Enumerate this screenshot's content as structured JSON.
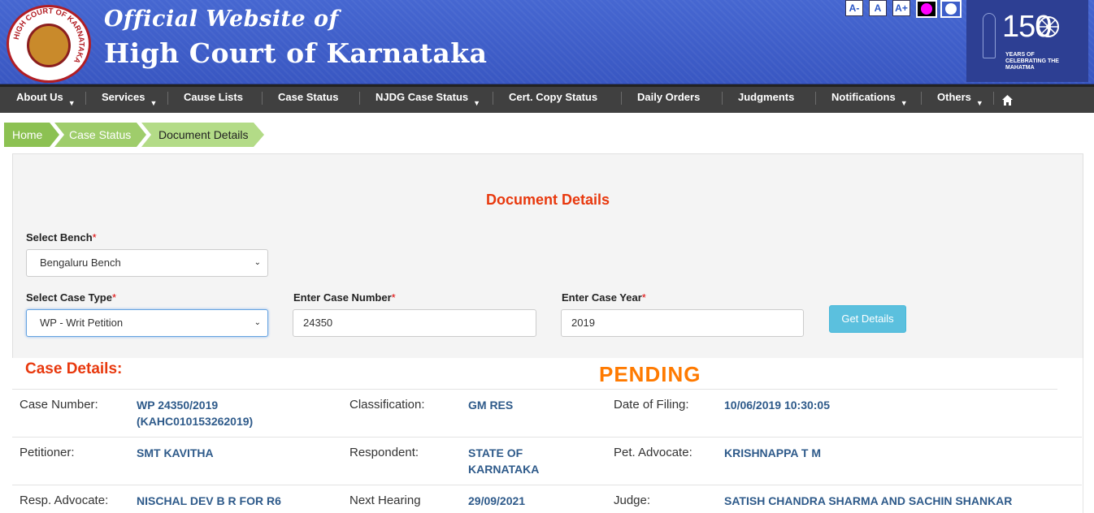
{
  "header": {
    "subtitle": "Official Website of",
    "title": "High Court of Karnataka",
    "logo_text": "HIGH COURT OF KARNATAKA",
    "font_buttons": [
      "A-",
      "A",
      "A+"
    ],
    "gandhi_number": "150",
    "gandhi_caption": "YEARS OF CELEBRATING THE MAHATMA"
  },
  "nav": {
    "items": [
      {
        "label": "About Us",
        "dropdown": true
      },
      {
        "label": "Services",
        "dropdown": true
      },
      {
        "label": "Cause Lists",
        "dropdown": false
      },
      {
        "label": "Case Status",
        "dropdown": false
      },
      {
        "label": "NJDG Case Status",
        "dropdown": true
      },
      {
        "label": "Cert. Copy Status",
        "dropdown": false
      },
      {
        "label": "Daily Orders",
        "dropdown": false
      },
      {
        "label": "Judgments",
        "dropdown": false
      },
      {
        "label": "Notifications",
        "dropdown": true
      },
      {
        "label": "Others",
        "dropdown": true
      }
    ]
  },
  "breadcrumb": [
    "Home",
    "Case Status",
    "Document Details"
  ],
  "form": {
    "title": "Document Details",
    "bench_label": "Select Bench",
    "bench_value": "Bengaluru Bench",
    "case_type_label": "Select Case Type",
    "case_type_value": "WP - Writ Petition",
    "case_number_label": "Enter Case Number",
    "case_number_value": "24350",
    "case_year_label": "Enter Case Year",
    "case_year_value": "2019",
    "submit_label": "Get Details",
    "required_mark": "*"
  },
  "case": {
    "heading": "Case Details:",
    "status": "PENDING",
    "rows": [
      [
        {
          "key": "Case Number:",
          "value": "WP 24350/2019 (KAHC010153262019)"
        },
        {
          "key": "Classification:",
          "value": "GM RES"
        },
        {
          "key": "Date of Filing:",
          "value": "10/06/2019 10:30:05"
        }
      ],
      [
        {
          "key": "Petitioner:",
          "value": "SMT KAVITHA"
        },
        {
          "key": "Respondent:",
          "value": "STATE OF KARNATAKA"
        },
        {
          "key": "Pet. Advocate:",
          "value": "KRISHNAPPA T M"
        }
      ],
      [
        {
          "key": "Resp. Advocate:",
          "value": "NISCHAL DEV B R FOR R6"
        },
        {
          "key": "Next Hearing",
          "value": "29/09/2021"
        },
        {
          "key": "Judge:",
          "value": "SATISH CHANDRA SHARMA AND SACHIN SHANKAR"
        }
      ]
    ]
  },
  "colors": {
    "header_blue": "#3d5ec9",
    "nav_bg": "#404040",
    "breadcrumb_green": "#8cc152",
    "title_red": "#e8380d",
    "pending_orange": "#ff7a00",
    "value_blue": "#2e5a8a",
    "button_info": "#5bc0de"
  }
}
